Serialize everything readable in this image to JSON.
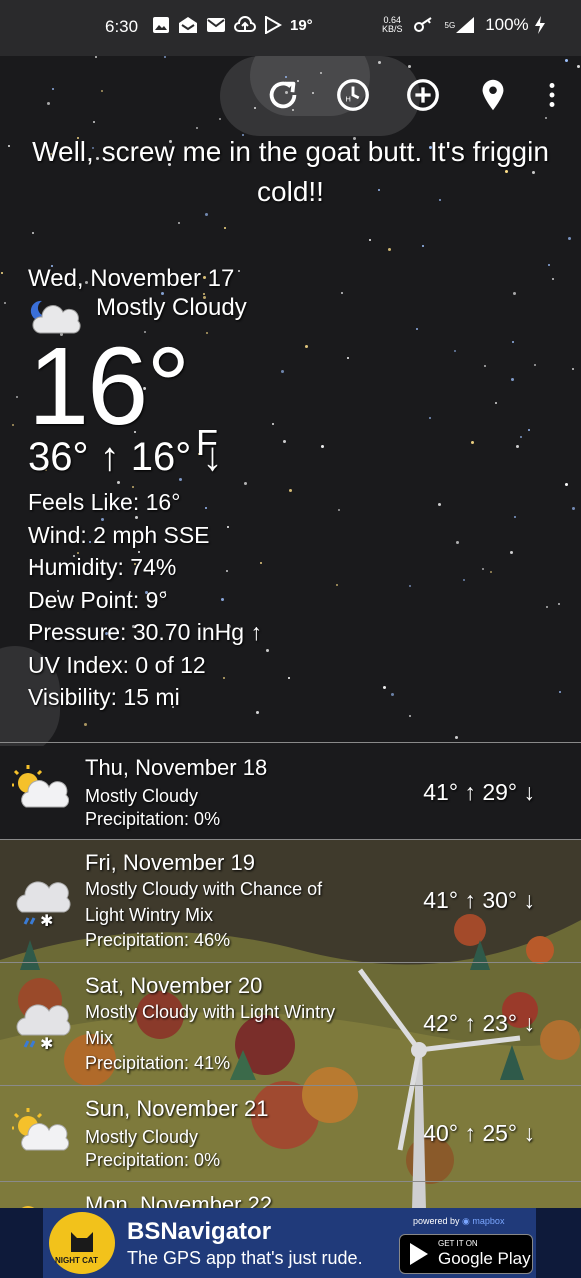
{
  "status_bar": {
    "time": "6:30",
    "temp": "19°",
    "net_speed_value": "0.64",
    "net_speed_unit": "KB/S",
    "network": "5G",
    "battery": "100%"
  },
  "toolbar": {
    "refresh_icon": "refresh-icon",
    "hourly_icon": "hourly-clock-icon",
    "add_icon": "add-location-icon",
    "location_icon": "location-pin-icon",
    "more_icon": "overflow-menu-icon"
  },
  "snark": "Well, screw me in the goat butt. It's friggin cold!!",
  "current": {
    "date": "Wed, November 17",
    "condition": "Mostly Cloudy",
    "temp": "16°",
    "unit": "F",
    "hi_lo": "36° ↑  16° ↓",
    "feels_like": "Feels Like:  16°",
    "wind": "Wind:  2 mph SSE",
    "humidity": "Humidity:  74%",
    "dew_point": "Dew Point:  9°",
    "pressure": "Pressure:  30.70 inHg ↑",
    "uv_index": "UV Index:  0 of 12",
    "visibility": "Visibility:  15 mi"
  },
  "forecast": [
    {
      "date": "Thu, November 18",
      "condition": "Mostly Cloudy",
      "precip": "Precipitation:  0%",
      "hilo": "41° ↑  29° ↓",
      "icon": "partly-sunny-icon"
    },
    {
      "date": "Fri, November 19",
      "condition": "Mostly Cloudy with Chance of Light Wintry Mix",
      "precip": "Precipitation:  46%",
      "hilo": "41° ↑  30° ↓",
      "icon": "wintry-mix-icon"
    },
    {
      "date": "Sat, November 20",
      "condition": "Mostly Cloudy with Light Wintry Mix",
      "precip": "Precipitation:  41%",
      "hilo": "42° ↑  23° ↓",
      "icon": "wintry-mix-icon"
    },
    {
      "date": "Sun, November 21",
      "condition": "Mostly Cloudy",
      "precip": "Precipitation:  0%",
      "hilo": "40° ↑  25° ↓",
      "icon": "partly-sunny-icon"
    },
    {
      "date": "Mon, November 22",
      "condition": "",
      "precip": "",
      "hilo": "",
      "icon": "partly-sunny-icon"
    }
  ],
  "ad": {
    "title": "BSNavigator",
    "tagline": "The GPS app that's just rude.",
    "logo_text": "NIGHT CAT",
    "powered_by": "powered by",
    "powered_brand": "mapbox",
    "store_small": "GET IT ON",
    "store_big": "Google Play"
  },
  "colors": {
    "sky": "#1a1a1c",
    "status_bar": "#2a2a2c",
    "divider": "#8a8a8a",
    "ad_bg": "#203a7a",
    "sun": "#f5c12b",
    "rain": "#3a7bd5"
  }
}
